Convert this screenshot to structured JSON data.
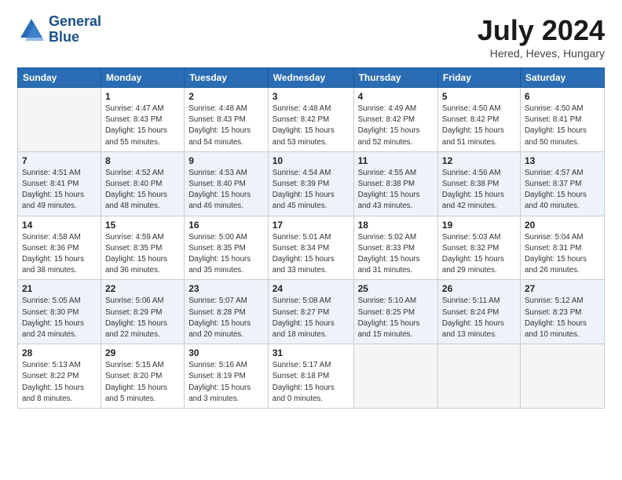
{
  "logo": {
    "line1": "General",
    "line2": "Blue"
  },
  "title": "July 2024",
  "subtitle": "Hered, Heves, Hungary",
  "days_of_week": [
    "Sunday",
    "Monday",
    "Tuesday",
    "Wednesday",
    "Thursday",
    "Friday",
    "Saturday"
  ],
  "weeks": [
    [
      {
        "num": "",
        "detail": ""
      },
      {
        "num": "1",
        "detail": "Sunrise: 4:47 AM\nSunset: 8:43 PM\nDaylight: 15 hours\nand 55 minutes."
      },
      {
        "num": "2",
        "detail": "Sunrise: 4:48 AM\nSunset: 8:43 PM\nDaylight: 15 hours\nand 54 minutes."
      },
      {
        "num": "3",
        "detail": "Sunrise: 4:48 AM\nSunset: 8:42 PM\nDaylight: 15 hours\nand 53 minutes."
      },
      {
        "num": "4",
        "detail": "Sunrise: 4:49 AM\nSunset: 8:42 PM\nDaylight: 15 hours\nand 52 minutes."
      },
      {
        "num": "5",
        "detail": "Sunrise: 4:50 AM\nSunset: 8:42 PM\nDaylight: 15 hours\nand 51 minutes."
      },
      {
        "num": "6",
        "detail": "Sunrise: 4:50 AM\nSunset: 8:41 PM\nDaylight: 15 hours\nand 50 minutes."
      }
    ],
    [
      {
        "num": "7",
        "detail": "Sunrise: 4:51 AM\nSunset: 8:41 PM\nDaylight: 15 hours\nand 49 minutes."
      },
      {
        "num": "8",
        "detail": "Sunrise: 4:52 AM\nSunset: 8:40 PM\nDaylight: 15 hours\nand 48 minutes."
      },
      {
        "num": "9",
        "detail": "Sunrise: 4:53 AM\nSunset: 8:40 PM\nDaylight: 15 hours\nand 46 minutes."
      },
      {
        "num": "10",
        "detail": "Sunrise: 4:54 AM\nSunset: 8:39 PM\nDaylight: 15 hours\nand 45 minutes."
      },
      {
        "num": "11",
        "detail": "Sunrise: 4:55 AM\nSunset: 8:38 PM\nDaylight: 15 hours\nand 43 minutes."
      },
      {
        "num": "12",
        "detail": "Sunrise: 4:56 AM\nSunset: 8:38 PM\nDaylight: 15 hours\nand 42 minutes."
      },
      {
        "num": "13",
        "detail": "Sunrise: 4:57 AM\nSunset: 8:37 PM\nDaylight: 15 hours\nand 40 minutes."
      }
    ],
    [
      {
        "num": "14",
        "detail": "Sunrise: 4:58 AM\nSunset: 8:36 PM\nDaylight: 15 hours\nand 38 minutes."
      },
      {
        "num": "15",
        "detail": "Sunrise: 4:59 AM\nSunset: 8:35 PM\nDaylight: 15 hours\nand 36 minutes."
      },
      {
        "num": "16",
        "detail": "Sunrise: 5:00 AM\nSunset: 8:35 PM\nDaylight: 15 hours\nand 35 minutes."
      },
      {
        "num": "17",
        "detail": "Sunrise: 5:01 AM\nSunset: 8:34 PM\nDaylight: 15 hours\nand 33 minutes."
      },
      {
        "num": "18",
        "detail": "Sunrise: 5:02 AM\nSunset: 8:33 PM\nDaylight: 15 hours\nand 31 minutes."
      },
      {
        "num": "19",
        "detail": "Sunrise: 5:03 AM\nSunset: 8:32 PM\nDaylight: 15 hours\nand 29 minutes."
      },
      {
        "num": "20",
        "detail": "Sunrise: 5:04 AM\nSunset: 8:31 PM\nDaylight: 15 hours\nand 26 minutes."
      }
    ],
    [
      {
        "num": "21",
        "detail": "Sunrise: 5:05 AM\nSunset: 8:30 PM\nDaylight: 15 hours\nand 24 minutes."
      },
      {
        "num": "22",
        "detail": "Sunrise: 5:06 AM\nSunset: 8:29 PM\nDaylight: 15 hours\nand 22 minutes."
      },
      {
        "num": "23",
        "detail": "Sunrise: 5:07 AM\nSunset: 8:28 PM\nDaylight: 15 hours\nand 20 minutes."
      },
      {
        "num": "24",
        "detail": "Sunrise: 5:08 AM\nSunset: 8:27 PM\nDaylight: 15 hours\nand 18 minutes."
      },
      {
        "num": "25",
        "detail": "Sunrise: 5:10 AM\nSunset: 8:25 PM\nDaylight: 15 hours\nand 15 minutes."
      },
      {
        "num": "26",
        "detail": "Sunrise: 5:11 AM\nSunset: 8:24 PM\nDaylight: 15 hours\nand 13 minutes."
      },
      {
        "num": "27",
        "detail": "Sunrise: 5:12 AM\nSunset: 8:23 PM\nDaylight: 15 hours\nand 10 minutes."
      }
    ],
    [
      {
        "num": "28",
        "detail": "Sunrise: 5:13 AM\nSunset: 8:22 PM\nDaylight: 15 hours\nand 8 minutes."
      },
      {
        "num": "29",
        "detail": "Sunrise: 5:15 AM\nSunset: 8:20 PM\nDaylight: 15 hours\nand 5 minutes."
      },
      {
        "num": "30",
        "detail": "Sunrise: 5:16 AM\nSunset: 8:19 PM\nDaylight: 15 hours\nand 3 minutes."
      },
      {
        "num": "31",
        "detail": "Sunrise: 5:17 AM\nSunset: 8:18 PM\nDaylight: 15 hours\nand 0 minutes."
      },
      {
        "num": "",
        "detail": ""
      },
      {
        "num": "",
        "detail": ""
      },
      {
        "num": "",
        "detail": ""
      }
    ]
  ]
}
